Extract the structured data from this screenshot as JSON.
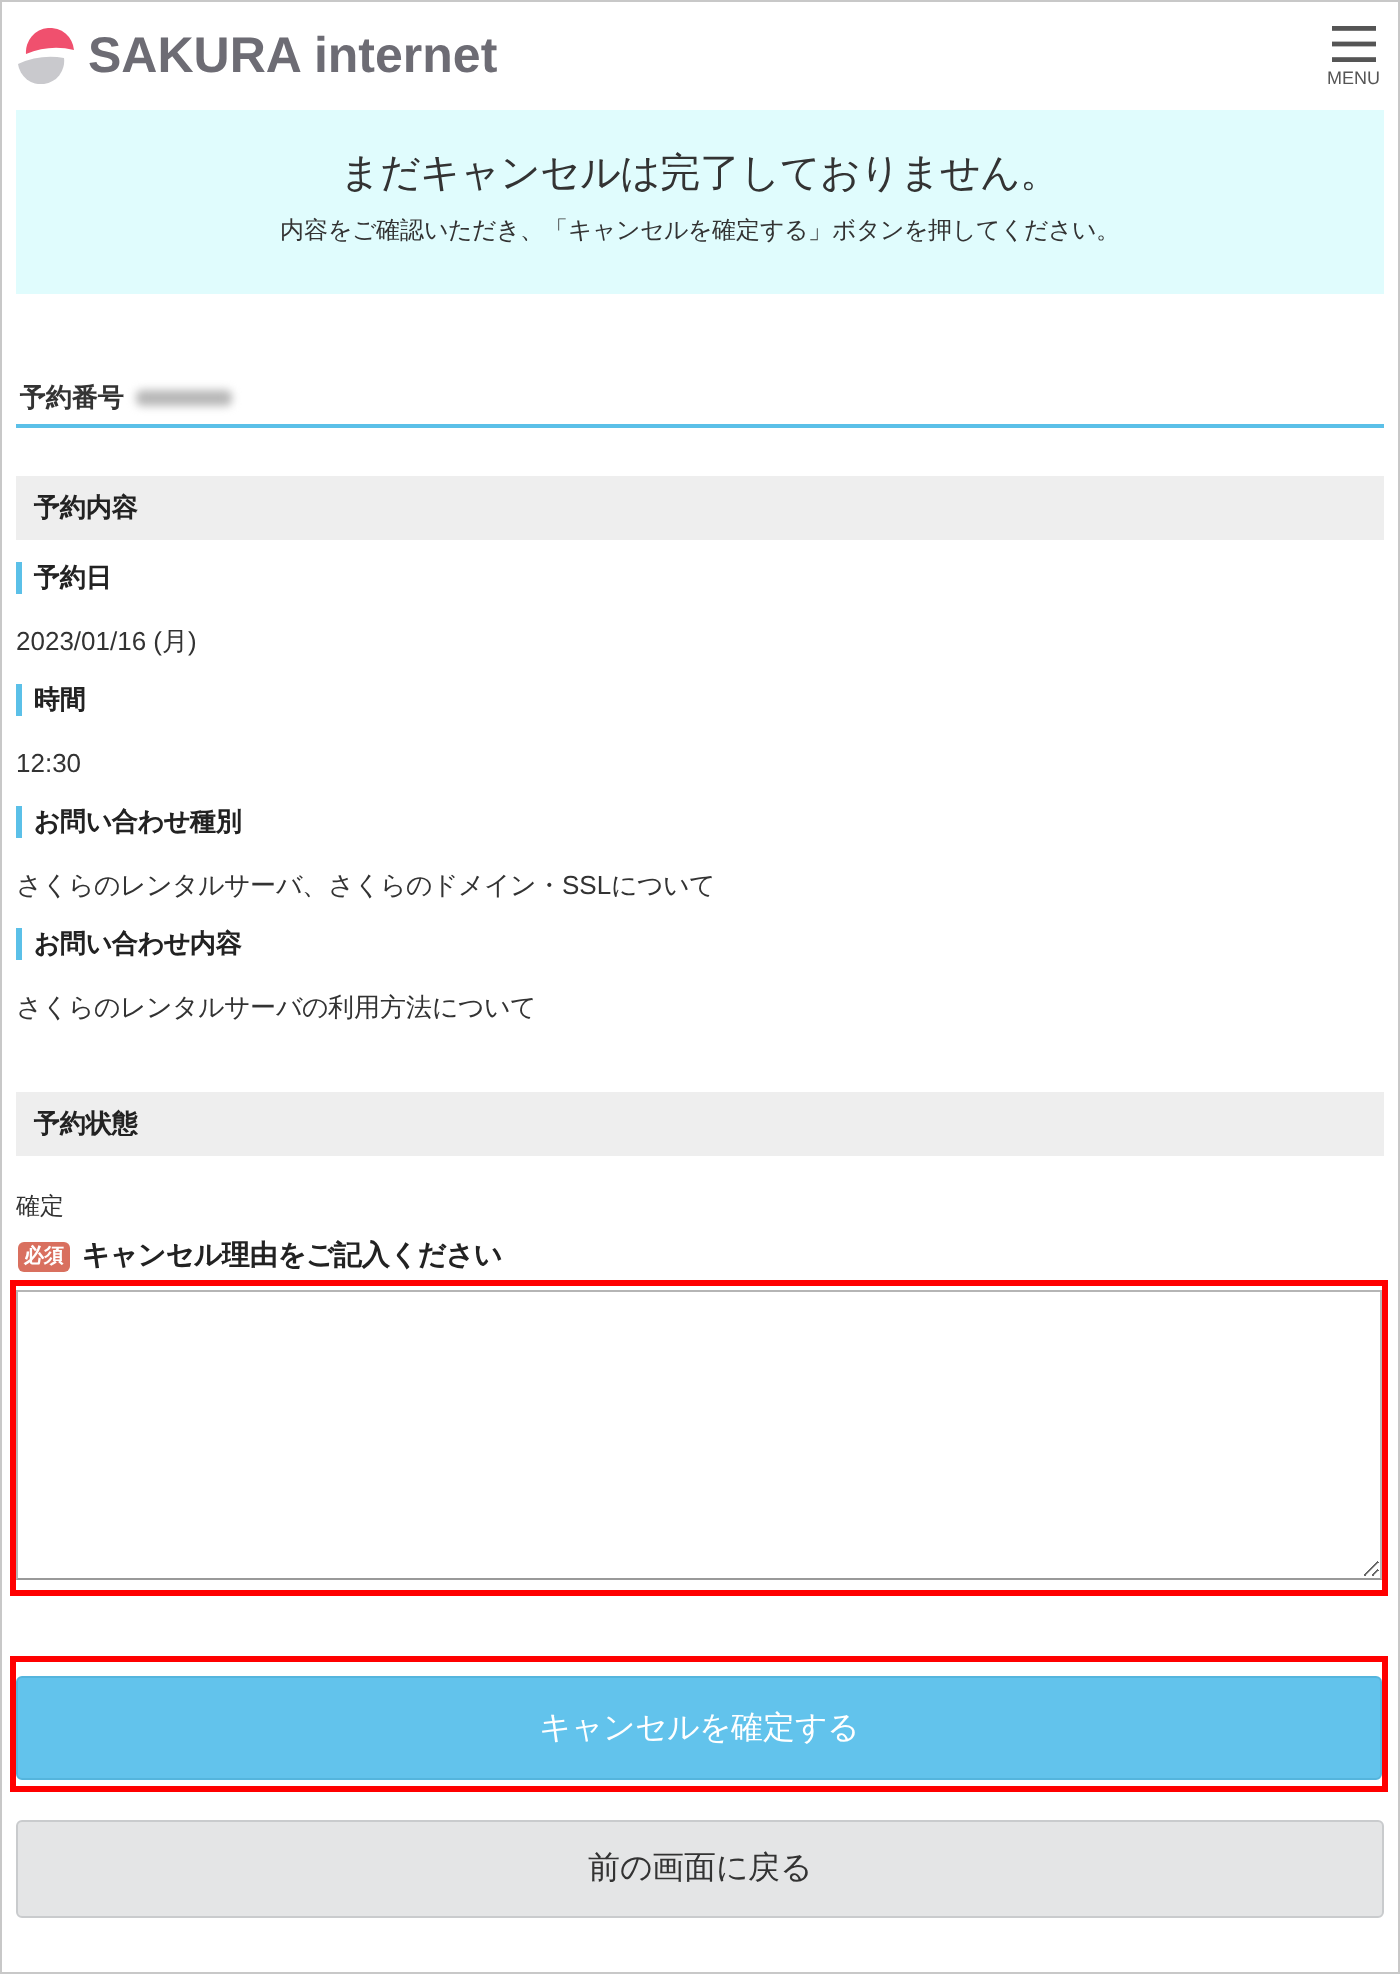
{
  "header": {
    "logo_text": "SAKURA internet",
    "menu_label": "MENU"
  },
  "notice": {
    "title": "まだキャンセルは完了しておりません。",
    "message": "内容をご確認いただき、「キャンセルを確定する」ボタンを押してください。"
  },
  "reservation_number": {
    "label": "予約番号",
    "value_blurred": true
  },
  "sections": [
    {
      "title": "予約内容",
      "fields": [
        {
          "label": "予約日",
          "value": "2023/01/16 (月)"
        },
        {
          "label": "時間",
          "value": "12:30"
        },
        {
          "label": "お問い合わせ種別",
          "value": "さくらのレンタルサーバ、さくらのドメイン・SSLについて"
        },
        {
          "label": "お問い合わせ内容",
          "value": "さくらのレンタルサーバの利用方法について"
        }
      ]
    },
    {
      "title": "予約状態",
      "fields": [
        {
          "value": "確定"
        }
      ]
    }
  ],
  "form": {
    "badge": "必須",
    "label": "キャンセル理由をご記入ください",
    "highlighted": true
  },
  "buttons": [
    {
      "label": "キャンセルを確定する",
      "kind": "primary",
      "highlighted": true
    },
    {
      "label": "前の画面に戻る",
      "kind": "secondary",
      "highlighted": false
    }
  ]
}
